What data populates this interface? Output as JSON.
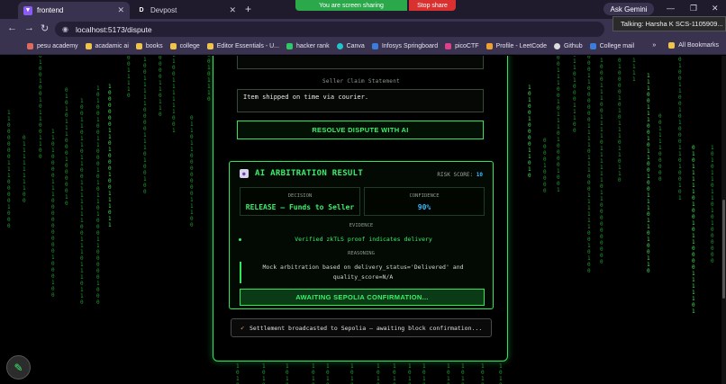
{
  "tabs": [
    {
      "title": "frontend",
      "active": true,
      "icon": "vite-icon"
    },
    {
      "title": "Devpost",
      "active": false,
      "icon": "devpost-icon"
    }
  ],
  "screen_share": {
    "status": "You are screen sharing",
    "stop_label": "Stop share"
  },
  "gemini_label": "Ask Gemini",
  "address": {
    "url": "localhost:5173/dispute"
  },
  "tooltip": "Talking: Harsha K SCS-1105909...",
  "bookmarks": [
    {
      "label": "pesu academy",
      "color": "#e06b5c"
    },
    {
      "label": "acadamic ai",
      "color": "#f0c34a"
    },
    {
      "label": "books",
      "color": "#f0c34a"
    },
    {
      "label": "college",
      "color": "#f0c34a"
    },
    {
      "label": "Editor Essentials - U...",
      "color": "#f0c34a"
    },
    {
      "label": "hacker rank",
      "color": "#2ec866"
    },
    {
      "label": "Canva",
      "color": "#20c4cb"
    },
    {
      "label": "Infosys Springboard",
      "color": "#3b7ddd"
    },
    {
      "label": "picoCTF",
      "color": "#e0408a"
    },
    {
      "label": "Profile - LeetCode",
      "color": "#f0a030"
    },
    {
      "label": "Github",
      "color": "#dddddd"
    },
    {
      "label": "College mail",
      "color": "#3b7ddd"
    }
  ],
  "all_bookmarks_label": "All Bookmarks",
  "dispute": {
    "seller_label": "Seller Claim Statement",
    "seller_statement": "Item shipped on time via courier.",
    "resolve_button": "RESOLVE DISPUTE WITH AI"
  },
  "result": {
    "title": "AI ARBITRATION RESULT",
    "risk_label": "RISK SCORE:",
    "risk_value": "10",
    "decision_label": "DECISION",
    "decision_value": "RELEASE — Funds to Seller",
    "confidence_label": "CONFIDENCE",
    "confidence_value": "90%",
    "evidence_label": "EVIDENCE",
    "evidence_item": "Verified zkTLS proof indicates delivery",
    "reasoning_label": "REASONING",
    "reasoning_text": "Mock arbitration based on delivery_status='Delivered' and quality_score=N/A",
    "await_button": "AWAITING SEPOLIA CONFIRMATION..."
  },
  "settlement": {
    "text": "Settlement broadcasted to Sepolia — awaiting block confirmation..."
  },
  "colors": {
    "accent": "#2ee85a",
    "confidence": "#3bb9ff"
  }
}
